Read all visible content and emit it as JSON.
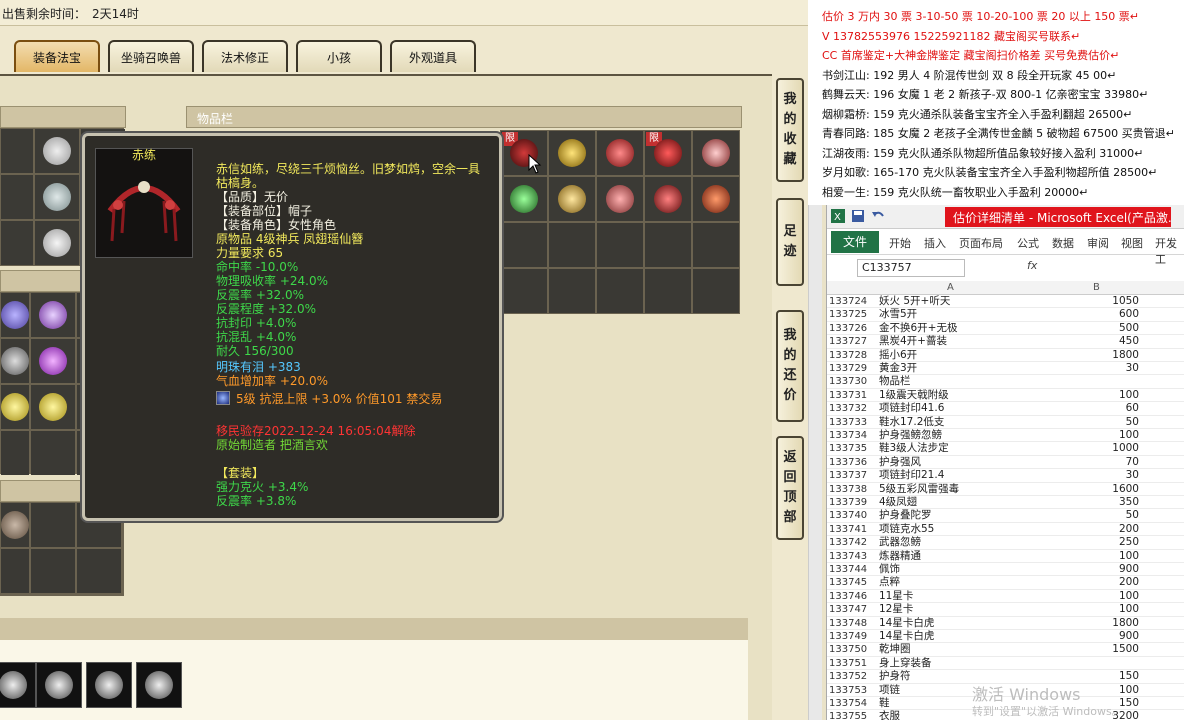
{
  "game": {
    "time_label": "出售剩余时间：",
    "time_value": "2天14时",
    "tabs": [
      "装备法宝",
      "坐骑召唤兽",
      "法术修正",
      "小孩",
      "外观道具"
    ],
    "items_panel_title": "物品栏",
    "limit_badge": "限",
    "side_nav": [
      "我的收藏",
      "足迹",
      "我的还价",
      "返回顶部"
    ]
  },
  "tooltip": {
    "name": "赤练",
    "desc1": "赤信如练，尽绕三千烦恼丝。旧梦如鸩，空余一具",
    "desc2": "枯槁身。",
    "quality": "【品质】无价",
    "slot": "【装备部位】帽子",
    "role": "【装备角色】女性角色",
    "origin": "原物品 4级神兵 凤翅瑶仙簪",
    "stats": [
      "力量要求 65",
      "命中率 -10.0%",
      "物理吸收率 +24.0%",
      "反震率 +32.0%",
      "反震程度 +32.0%",
      "抗封印 +4.0%",
      "抗混乱 +4.0%",
      "耐久 156/300"
    ],
    "gem": "明珠有泪 +383",
    "hp_boost": "气血增加率 +20.0%",
    "stone": "5级 抗混上限 +3.0% 价值101 禁交易",
    "transfer": "移民验存2022-12-24 16:05:04解除",
    "enchant": "原始制造者  把酒言欢",
    "set_title": "【套装】",
    "set1": "强力克火 +3.4%",
    "set2": "反震率 +3.8%"
  },
  "right_text": [
    {
      "t": "估价 3 万内 30 票    3-10-50 票    10-20-100 票    20 以上 150 票↵",
      "c": "#e01010"
    },
    {
      "t": "V 13782553976      15225921182    藏宝阁买号联系↵",
      "c": "#e01010"
    },
    {
      "t": "CC 首席鉴定+大神金牌鉴定  藏宝阁扫价格差  买号免费估价↵",
      "c": "#e01010"
    },
    {
      "t": "书剑江山:  192 男人 4 阶混传世剑  双 8 段全开玩家  45 00↵",
      "c": "#111"
    },
    {
      "t": "鹤舞云天:  196 女魔 1 老 2 新孩子-双 800-1 亿亲密宝宝 33980↵",
      "c": "#111"
    },
    {
      "t": "烟柳霜桥:  159 克火通杀队装备宝宝齐全入手盈利翻超 26500↵",
      "c": "#111"
    },
    {
      "t": "青春同路:  185 女魔 2 老孩子全满传世金麟 5 破物超 67500 买贵管退↵",
      "c": "#111"
    },
    {
      "t": "江湖夜雨:  159 克火队通杀队物超所值品象较好接入盈利 31000↵",
      "c": "#111"
    },
    {
      "t": "岁月如歌:  165-170 克火队装备宝宝齐全入手盈利物超所值 28500↵",
      "c": "#111"
    },
    {
      "t": "相爱一生:  159 克火队统一畜牧职业入手盈利 20000↵",
      "c": "#111"
    }
  ],
  "excel": {
    "title": "估价详细清单 - Microsoft Excel(产品激...",
    "ribbon": [
      "开始",
      "插入",
      "页面布局",
      "公式",
      "数据",
      "审阅",
      "视图",
      "开发工"
    ],
    "file_tab": "文件",
    "name_box": "C133757",
    "fx": "fx",
    "col_a": "A",
    "col_b": "B",
    "rows": [
      [
        "133724",
        "妖火 5开+听天",
        "1050"
      ],
      [
        "133725",
        "冰雪5开",
        "600"
      ],
      [
        "133726",
        "金不换6开+无极",
        "500"
      ],
      [
        "133727",
        "黑炭4开+蔷装",
        "450"
      ],
      [
        "133728",
        "摇小6开",
        "1800"
      ],
      [
        "133729",
        "黄金3开",
        "30"
      ],
      [
        "133730",
        "物品栏",
        ""
      ],
      [
        "133731",
        "1级震天戟附级",
        "100"
      ],
      [
        "133732",
        "项链封印41.6",
        "60"
      ],
      [
        "133733",
        "鞋水17.2低支",
        "50"
      ],
      [
        "133734",
        "护身强鳑忽鳑",
        "100"
      ],
      [
        "133735",
        "鞋3级人法步定",
        "1000"
      ],
      [
        "133736",
        "护身强风",
        "70"
      ],
      [
        "133737",
        "项链封印21.4",
        "30"
      ],
      [
        "133738",
        "5级五彩风雷强毒",
        "1600"
      ],
      [
        "133739",
        "4级凤翅",
        "350"
      ],
      [
        "133740",
        "护身叠陀罗",
        "50"
      ],
      [
        "133741",
        "项链克水55",
        "200"
      ],
      [
        "133742",
        "武器忽鳑",
        "250"
      ],
      [
        "133743",
        "炼器精通",
        "100"
      ],
      [
        "133744",
        "佩饰",
        "900"
      ],
      [
        "133745",
        "点粹",
        "200"
      ],
      [
        "133746",
        "11星卡",
        "100"
      ],
      [
        "133747",
        "12星卡",
        "100"
      ],
      [
        "133748",
        "14星卡白虎",
        "1800"
      ],
      [
        "133749",
        "14星卡白虎",
        "900"
      ],
      [
        "133750",
        "乾坤圈",
        "1500"
      ],
      [
        "133751",
        "身上穿装备",
        ""
      ],
      [
        "133752",
        "护身符",
        "150"
      ],
      [
        "133753",
        "项链",
        "100"
      ],
      [
        "133754",
        "鞋",
        "150"
      ],
      [
        "133755",
        "衣服",
        "3200"
      ]
    ]
  },
  "watermark": {
    "line1": "激活 Windows",
    "line2": "转到\"设置\"以激活 Windows。"
  }
}
